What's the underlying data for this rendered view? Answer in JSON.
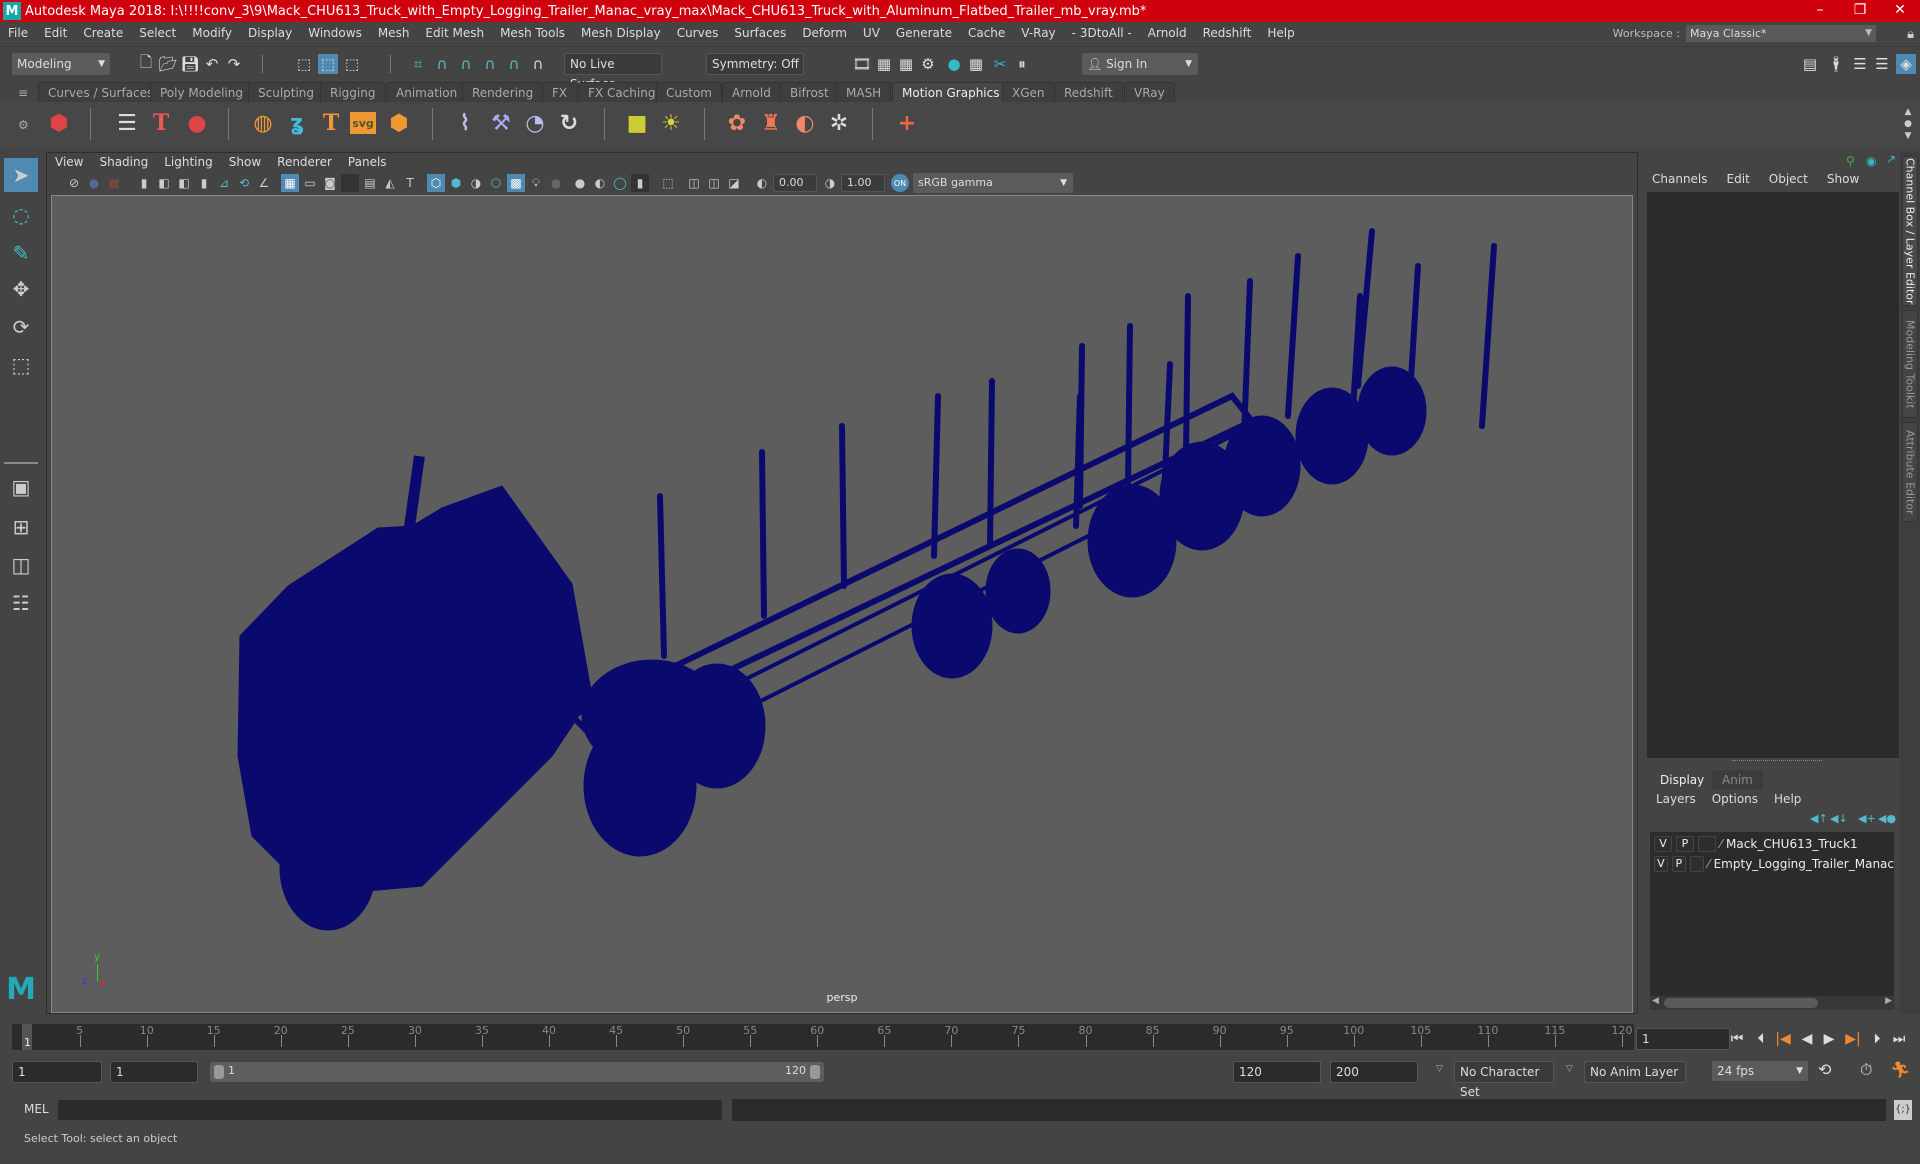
{
  "app": {
    "title": "Autodesk Maya 2018: I:\\!!!!conv_3\\9\\Mack_CHU613_Truck_with_Empty_Logging_Trailer_Manac_vray_max\\Mack_CHU613_Truck_with_Aluminum_Flatbed_Trailer_mb_vray.mb*",
    "window_controls": {
      "minimize": "–",
      "maximize": "❐",
      "close": "✕"
    }
  },
  "menubar": [
    "File",
    "Edit",
    "Create",
    "Select",
    "Modify",
    "Display",
    "Windows",
    "Mesh",
    "Edit Mesh",
    "Mesh Tools",
    "Mesh Display",
    "Curves",
    "Surfaces",
    "Deform",
    "UV",
    "Generate",
    "Cache",
    "V-Ray",
    "- 3DtoAll -",
    "Arnold",
    "Redshift",
    "Help"
  ],
  "workspace": {
    "label": "Workspace :",
    "value": "Maya Classic*"
  },
  "statusline": {
    "mode": "Modeling",
    "live_surface": "No Live Surface",
    "symmetry": "Symmetry: Off",
    "sign_in": "Sign In"
  },
  "shelf": {
    "tabs": [
      "Curves / Surfaces",
      "Poly Modeling",
      "Sculpting",
      "Rigging",
      "Animation",
      "Rendering",
      "FX",
      "FX Caching",
      "Custom",
      "Arnold",
      "Bifrost",
      "MASH",
      "Motion Graphics",
      "XGen",
      "Redshift",
      "VRay"
    ],
    "active_tab": "Motion Graphics",
    "icons": [
      "mash-network-icon",
      "text-list-icon",
      "type-tool-icon",
      "mash-paint-icon",
      "sphere-icon",
      "curve-icon",
      "type-icon",
      "svg-icon",
      "box-icon",
      "sweep-icon",
      "fracture-icon",
      "dynamics-icon",
      "spring-icon",
      "light-icon",
      "sun-icon",
      "flight-icon",
      "blend-icon",
      "explode-icon",
      "world-icon",
      "plus-icon"
    ],
    "svg_label": "svg"
  },
  "viewport": {
    "menu": [
      "View",
      "Shading",
      "Lighting",
      "Show",
      "Renderer",
      "Panels"
    ],
    "exposure": "0.00",
    "gamma": "1.00",
    "color_space": "sRGB gamma",
    "camera": "persp",
    "wire_color": "#0a0a6e",
    "axis": {
      "x": "x",
      "y": "y",
      "z": "z"
    }
  },
  "channel_box": {
    "menu": [
      "Channels",
      "Edit",
      "Object",
      "Show"
    ]
  },
  "side_tabs": [
    "Channel Box / Layer Editor",
    "Modeling Toolkit",
    "Attribute Editor"
  ],
  "layer_editor": {
    "tabs": [
      "Display",
      "Anim"
    ],
    "active_tab": "Display",
    "menu": [
      "Layers",
      "Options",
      "Help"
    ],
    "layers": [
      {
        "v": "V",
        "p": "P",
        "name": "Mack_CHU613_Truck1"
      },
      {
        "v": "V",
        "p": "P",
        "name": "Empty_Logging_Trailer_Manac"
      }
    ]
  },
  "timeline": {
    "ticks": [
      5,
      10,
      15,
      20,
      25,
      30,
      35,
      40,
      45,
      50,
      55,
      60,
      65,
      70,
      75,
      80,
      85,
      90,
      95,
      100,
      105,
      110,
      115,
      120
    ],
    "current_frame": "1",
    "current_frame_field": "1",
    "start_value": 1,
    "end_value": 120
  },
  "range": {
    "start": "1",
    "playback_start": "1",
    "slider_start": "1",
    "slider_end": "120",
    "playback_end": "120",
    "end": "200",
    "character_set": "No Character Set",
    "anim_layer": "No Anim Layer",
    "fps": "24 fps"
  },
  "command_line": {
    "label": "MEL"
  },
  "help_line": "Select Tool: select an object"
}
